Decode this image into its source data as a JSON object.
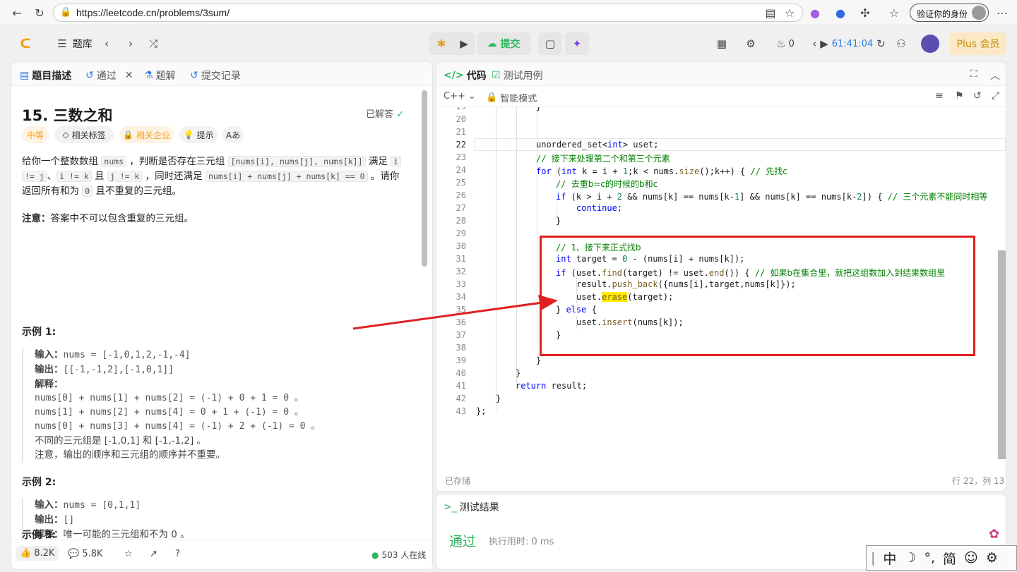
{
  "browser": {
    "url": "https://leetcode.cn/problems/3sum/",
    "verify": "验证你的身份"
  },
  "topbar": {
    "problemset": "题库",
    "submit": "提交",
    "timer": "61:41:04",
    "fire_count": "0",
    "plus": "Plus 会员"
  },
  "left_tabs": {
    "desc": "题目描述",
    "passed": "通过",
    "solution": "题解",
    "submissions": "提交记录"
  },
  "problem": {
    "title": "15. 三数之和",
    "solved": "已解答",
    "tags": {
      "difficulty": "中等",
      "related_tags": "相关标签",
      "companies": "相关企业",
      "hint": "提示",
      "font": "Aあ"
    },
    "desc_1": "给你一个整数数组 ",
    "nums": "nums",
    "desc_2": " ，判断是否存在三元组 ",
    "triple": "[nums[i], nums[j], nums[k]]",
    "desc_3": " 满足 ",
    "i_": "i",
    "ne_j": "!= j",
    "desc_4": "、",
    "i_ne_k": "i != k",
    "desc_5": " 且 ",
    "j_ne_k": "j != k",
    "desc_6": " ，同时还满足 ",
    "sum_eq": "nums[i] + nums[j] + nums[k] == 0",
    "desc_7": " 。请你",
    "desc_8": "返回所有和为 ",
    "zero": "0",
    "desc_9": " 且不重复的三元组。",
    "note_label": "注意：",
    "note_text": "答案中不可以包含重复的三元组。",
    "ex1_title": "示例 1:",
    "ex1_in_label": "输入：",
    "ex1_in": "nums = [-1,0,1,2,-1,-4]",
    "ex1_out_label": "输出：",
    "ex1_out": "[[-1,-1,2],[-1,0,1]]",
    "ex1_exp_label": "解释：",
    "ex1_l1": "nums[0] + nums[1] + nums[2] = (-1) + 0 + 1 = 0 。",
    "ex1_l2": "nums[1] + nums[2] + nums[4] = 0 + 1 + (-1) = 0 。",
    "ex1_l3": "nums[0] + nums[3] + nums[4] = (-1) + 2 + (-1) = 0 。",
    "ex1_l4": "不同的三元组是 [-1,0,1] 和 [-1,-1,2] 。",
    "ex1_l5": "注意，输出的顺序和三元组的顺序并不重要。",
    "ex2_title": "示例 2:",
    "ex2_in": "nums = [0,1,1]",
    "ex2_out": "[]",
    "ex2_exp": "唯一可能的三元组和不为 0 。",
    "ex3_title": "示例 3:"
  },
  "left_footer": {
    "likes": "8.2K",
    "comments": "5.8K",
    "online": "503 人在线"
  },
  "code_tabs": {
    "code": "代码",
    "testcase": "测试用例"
  },
  "code_toolbar": {
    "lang": "C++",
    "mode": "智能模式"
  },
  "editor": {
    "saved": "已存储",
    "position": "行 22，列 13"
  },
  "result": {
    "title": "测试结果",
    "status": "通过",
    "runtime": "执行用时: 0 ms"
  },
  "ime": {
    "items": [
      "中",
      "☽",
      "°,",
      "简",
      "☺",
      "⚙"
    ]
  }
}
